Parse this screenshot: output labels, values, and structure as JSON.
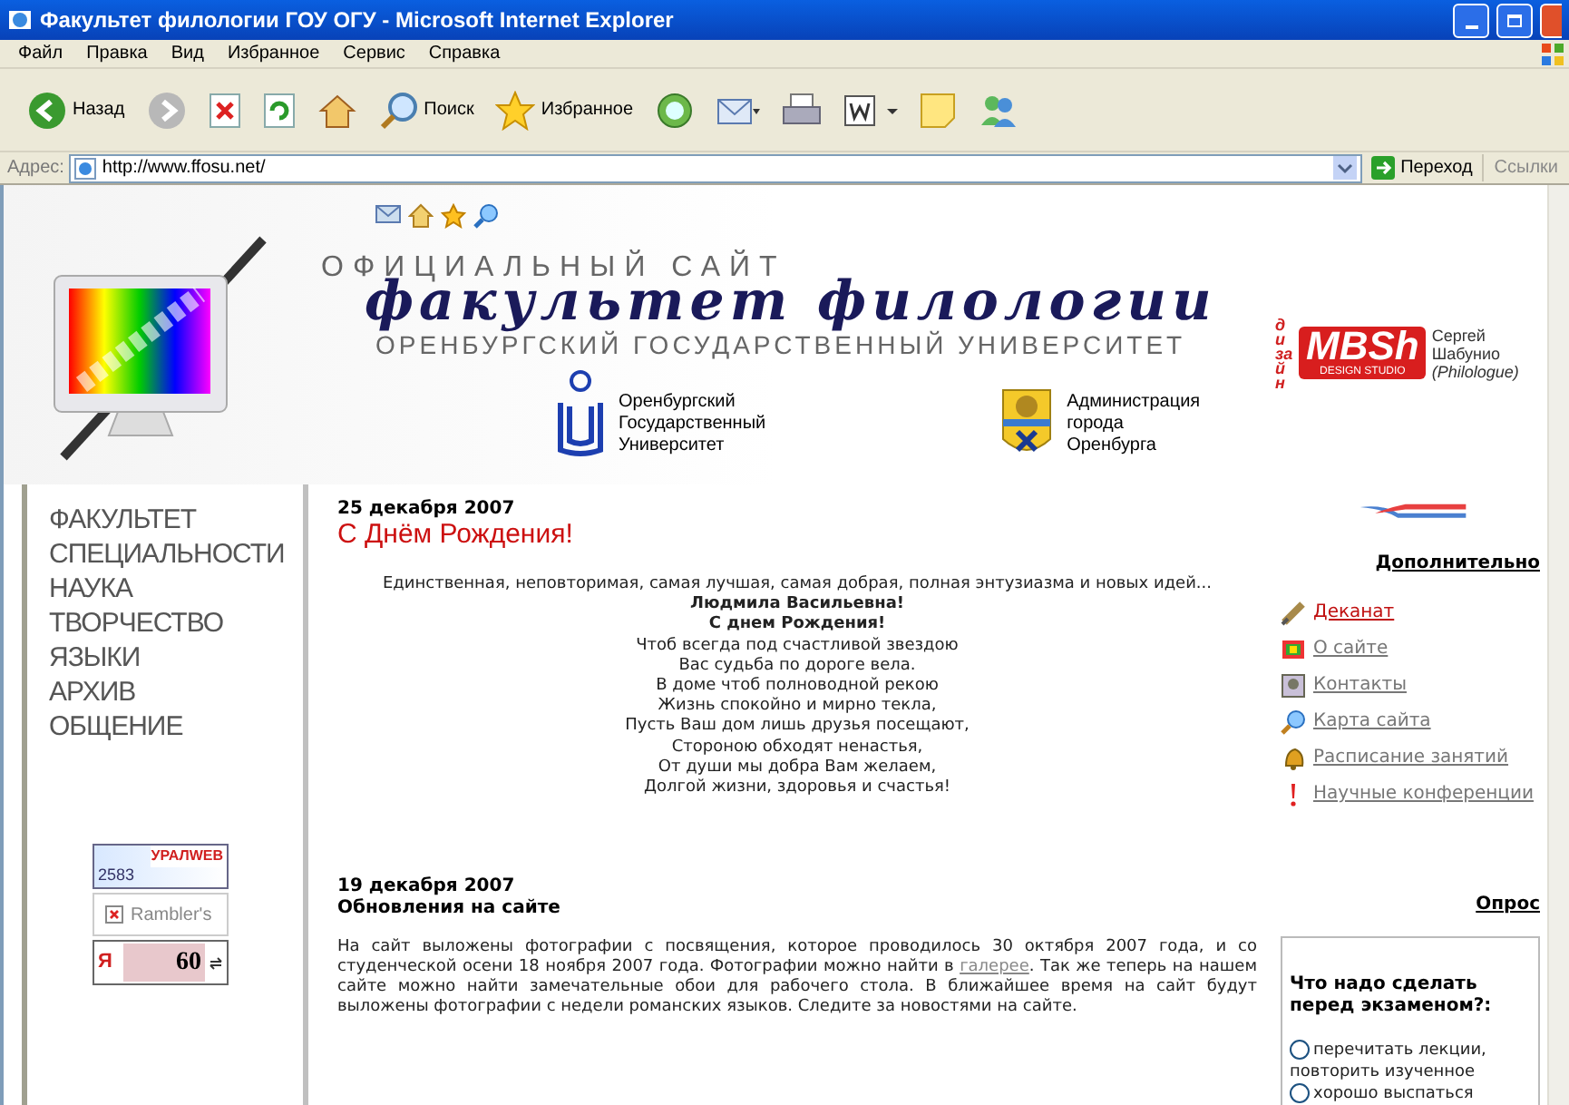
{
  "window": {
    "title": "Факультет филологии ГОУ ОГУ - Microsoft Internet Explorer"
  },
  "menu": [
    "Файл",
    "Правка",
    "Вид",
    "Избранное",
    "Сервис",
    "Справка"
  ],
  "toolbar": [
    {
      "kind": "back",
      "label": "Назад"
    },
    {
      "kind": "forward"
    },
    {
      "kind": "stop"
    },
    {
      "kind": "refresh"
    },
    {
      "kind": "home"
    },
    {
      "kind": "search",
      "label": "Поиск"
    },
    {
      "kind": "favorites",
      "label": "Избранное"
    },
    {
      "kind": "media"
    },
    {
      "kind": "mail"
    },
    {
      "kind": "print"
    },
    {
      "kind": "word"
    },
    {
      "kind": "note"
    },
    {
      "kind": "messenger"
    }
  ],
  "address": {
    "label": "Адрес:",
    "value": "http://www.ffosu.net/",
    "go": "Переход",
    "links": "Ссылки"
  },
  "header": {
    "line1": "ОФИЦИАЛЬНЫЙ САЙТ",
    "title": "факультет филологии",
    "line2": "ОРЕНБУРГСКИЙ ГОСУДАРСТВЕННЫЙ УНИВЕРСИТЕТ",
    "partners": [
      {
        "kind": "university",
        "lines": [
          "Оренбургский",
          "Государственный",
          "Университет"
        ]
      },
      {
        "kind": "city",
        "lines": [
          "Администрация",
          "города",
          "Оренбурга"
        ]
      }
    ],
    "designer": {
      "tag": "дизайн",
      "logo": "MBSh",
      "studio": "DESIGN STUDIO",
      "name": [
        "Сергей",
        "Шабунио",
        "(Philologue)"
      ]
    }
  },
  "nav": [
    "ФАКУЛЬТЕТ",
    "СПЕЦИАЛЬНОСТИ",
    "НАУКА",
    "ТВОРЧЕСТВО",
    "ЯЗЫКИ",
    "АРХИВ",
    "ОБЩЕНИЕ"
  ],
  "counters": {
    "uralweb": {
      "count": "2583",
      "logo": "УРАЛWEB"
    },
    "rambler": "Rambler's",
    "yandex": {
      "letter": "Я",
      "count": "60"
    }
  },
  "news": [
    {
      "date": "25 декабря 2007",
      "title": "С Днём Рождения!",
      "kind": "poem",
      "lines": [
        {
          "text": "Единственная, неповторимая, самая лучшая, самая добрая, полная энтузиазма и новых идей...",
          "bold": false
        },
        {
          "text": "Людмила Васильевна!",
          "bold": true
        },
        {
          "text": "С днем Рождения!",
          "bold": true
        },
        {
          "text": "Чтоб всегда под счастливой звездою",
          "bold": false
        },
        {
          "text": "Вас судьба по дороге вела.",
          "bold": false
        },
        {
          "text": "В доме чтоб полноводной рекою",
          "bold": false
        },
        {
          "text": "Жизнь спокойно и мирно текла,",
          "bold": false
        },
        {
          "text": "Пусть Ваш дом лишь друзья посещают,",
          "bold": false
        },
        {
          "text": "Стороною обходят ненастья,",
          "bold": false
        },
        {
          "text": "От души мы добра Вам желаем,",
          "bold": false
        },
        {
          "text": "Долгой жизни, здоровья и счастья!",
          "bold": false
        }
      ]
    },
    {
      "date": "19 декабря 2007",
      "title": "Обновления на сайте",
      "kind": "article",
      "before": "На сайт выложены фотографии с посвящения, которое проводилось 30 октября 2007 года, и со студенческой осени 18 ноября 2007 года. Фотографии можно найти в",
      "link": "галерее",
      "after": ". Так же теперь на нашем сайте можно найти замечательные обои для рабочего стола. В ближайшее время на сайт будут выложены фотографии с недели романских языков. Следите за новостями на сайте."
    }
  ],
  "extra": {
    "title": "Дополнительно",
    "links": [
      {
        "kind": "scroll",
        "label": "Деканат",
        "active": true
      },
      {
        "kind": "picture",
        "label": "О сайте",
        "active": false
      },
      {
        "kind": "people",
        "label": "Контакты",
        "active": false
      },
      {
        "kind": "search",
        "label": "Карта сайта",
        "active": false
      },
      {
        "kind": "bell",
        "label": "Расписание занятий",
        "active": false
      },
      {
        "kind": "exclaim",
        "label": "Научные конференции",
        "active": false
      }
    ]
  },
  "poll": {
    "title": "Опрос",
    "question": "Что надо сделать перед экзаменом?:",
    "options": [
      {
        "label": "перечитать лекции, повторить изученное",
        "selected": false
      },
      {
        "label": "хорошо выспаться",
        "selected": false
      }
    ]
  }
}
